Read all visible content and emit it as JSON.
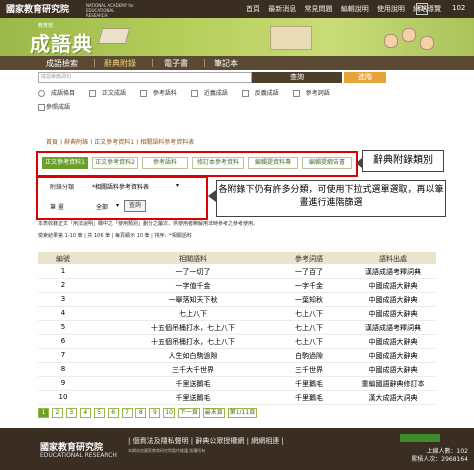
{
  "header": {
    "org_name": "國家教育研究院",
    "org_sub": "NATIONAL ACADEMY for EDUCATIONAL RESEARCH",
    "links": [
      "首頁",
      "最新消息",
      "常見問題",
      "編輯說明",
      "使用說明",
      "網站導覽"
    ],
    "lang": "EN",
    "counter": "102"
  },
  "banner": {
    "small": "教育部",
    "title": "成語典"
  },
  "nav": {
    "items": [
      "成語檢索",
      "辭典附錄",
      "電子書",
      "筆記本"
    ],
    "active": 1
  },
  "search": {
    "placeholder": "成語單篇詞句",
    "button": "查詢",
    "advanced": "進階"
  },
  "options": {
    "scope": [
      "成語條目",
      "正文成語",
      "參考語料",
      "近義成語",
      "反義成語",
      "參考詞語"
    ],
    "extra": "參照成語"
  },
  "breadcrumb": "首頁 ) 辭典附錄 ) 正文參考資料1 ) 相關語料參考資料表",
  "tabs": [
    "正文參考資料1",
    "正文參考資料2",
    "參考語料",
    "修訂本參考資料",
    "編輯提資料專",
    "編輯提綱告書"
  ],
  "callout_tabs": "辭典附錄類別",
  "filter": {
    "label_category": "附錄分類",
    "category_value": "*相關語料參考資料表",
    "label_stroke": "筆  畫",
    "stroke_value": "全部",
    "query_button": "查詢"
  },
  "callout_filter": "各附錄下仍有許多分類，可使用下拉式選單選取，再以筆畫進行進階篩選",
  "description": "本表收錄正文「用法說明」欄中之「使用類別」劃分之屬次，供使用者瞭解用法時參考之參考使用。",
  "pager_top": "檢索結果第 1-10 筆 | 共 106 筆 | 每頁顯示 10 筆 | 排序：*相關語料",
  "table": {
    "headers": [
      "編號",
      "相關語料",
      "參考詞語",
      "語料出處"
    ],
    "rows": [
      [
        "1",
        "一了一切了",
        "一了百了",
        "漢語成語考釋詞典"
      ],
      [
        "2",
        "一字值千金",
        "一字千金",
        "中國成語大辭典"
      ],
      [
        "3",
        "一舉落知天下秋",
        "一葉知秋",
        "中國成語大辭典"
      ],
      [
        "4",
        "七上八下",
        "七上八下",
        "中國成語大辭典"
      ],
      [
        "5",
        "十五個吊桶打水，七上八下",
        "七上八下",
        "漢語成語考釋詞典"
      ],
      [
        "6",
        "十五個吊桶打水，七上八下",
        "七上八下",
        "中國成語大辭典"
      ],
      [
        "7",
        "人生如白駒過隙",
        "白駒過隙",
        "中國成語大辭典"
      ],
      [
        "8",
        "三千大千世界",
        "三千世界",
        "中國成語大辭典"
      ],
      [
        "9",
        "千里送鵝毛",
        "千里鵝毛",
        "重編國語辭典修訂本"
      ],
      [
        "10",
        "千里送鵝毛",
        "千里鵝毛",
        "漢大成語大詞典"
      ]
    ]
  },
  "pager_bottom": {
    "pages": [
      "1",
      "2",
      "3",
      "4",
      "5",
      "6",
      "7",
      "8",
      "9",
      "10"
    ],
    "next": "下一頁",
    "last": "最末頁",
    "info": "第1/11頁"
  },
  "footer": {
    "org": "國家教育研究院",
    "org_en": "EDUCATIONAL RESEARCH",
    "links": "| 個資法及隱私聲明 | 辭典公眾授權網 | 網網相連 |",
    "info": "本網站由國家教育研究院製作維護 版權所有",
    "visits_label": "上線人數",
    "visits": "102",
    "total_label": "累積人次",
    "total": "2968164"
  },
  "colors": {
    "topbar": "#3a2e22",
    "banner": "#a9c35a",
    "accent": "#6aa02a",
    "highlight": "#dd0000",
    "search_button": "#4e3f2c",
    "advanced_button": "#e8a23a"
  }
}
